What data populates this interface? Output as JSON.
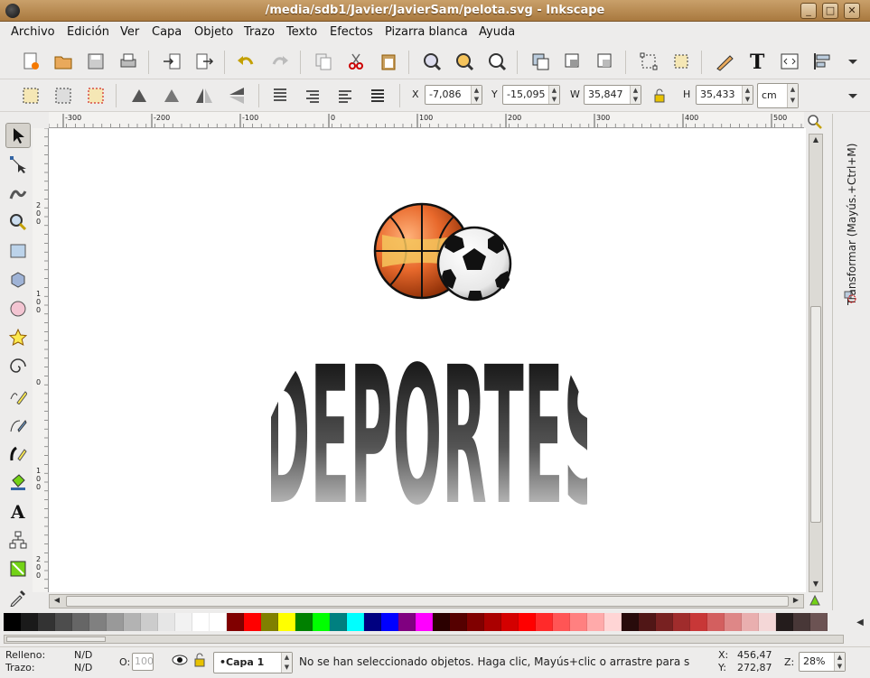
{
  "window": {
    "title": "/media/sdb1/Javier/JavierSam/pelota.svg - Inkscape",
    "buttons": [
      "_",
      "□",
      "✕"
    ]
  },
  "menu": [
    "Archivo",
    "Edición",
    "Ver",
    "Capa",
    "Objeto",
    "Trazo",
    "Texto",
    "Efectos",
    "Pizarra blanca",
    "Ayuda"
  ],
  "toolbar2": {
    "x": {
      "label": "X",
      "value": "-7,086"
    },
    "y": {
      "label": "Y",
      "value": "-15,095"
    },
    "w": {
      "label": "W",
      "value": "35,847"
    },
    "h": {
      "label": "H",
      "value": "35,433"
    },
    "unit": "cm"
  },
  "ruler": {
    "h_ticks": [
      "-300",
      "-200",
      "-100",
      "0",
      "100",
      "200",
      "300",
      "400",
      "500"
    ],
    "v_ticks": [
      "200",
      "100",
      "0",
      "100",
      "200"
    ]
  },
  "canvas": {
    "artwork_text": "DEPORTES",
    "ball_colors": {
      "basket": "#e8692c",
      "basket_accent": "#f5c45c",
      "soccer": "#111111"
    }
  },
  "dock": {
    "label": "Transformar (Mayús.+Ctrl+M)"
  },
  "palette": [
    "#000000",
    "#1a1a1a",
    "#333333",
    "#4d4d4d",
    "#666666",
    "#808080",
    "#999999",
    "#b3b3b3",
    "#cccccc",
    "#e6e6e6",
    "#f2f2f2",
    "#ffffff",
    "#ffffff",
    "#800000",
    "#ff0000",
    "#808000",
    "#ffff00",
    "#008000",
    "#00ff00",
    "#008080",
    "#00ffff",
    "#000080",
    "#0000ff",
    "#800080",
    "#ff00ff",
    "#2b0000",
    "#550000",
    "#800000",
    "#aa0000",
    "#d40000",
    "#ff0000",
    "#ff2a2a",
    "#ff5555",
    "#ff8080",
    "#ffaaaa",
    "#ffd5d5",
    "#280b0b",
    "#501616",
    "#782121",
    "#a02c2c",
    "#c83737",
    "#d35f5f",
    "#de8787",
    "#e9afaf",
    "#f4d7d7",
    "#241c1c",
    "#483737",
    "#6c5353"
  ],
  "status": {
    "fill_label": "Relleno:",
    "fill_value": "N/D",
    "stroke_label": "Trazo:",
    "stroke_value": "N/D",
    "opacity_label": "O:",
    "opacity_value": "100",
    "layer": "•Capa 1",
    "message": "No se han seleccionado objetos. Haga clic, Mayús+clic o arrastre para s",
    "x_label": "X:",
    "x_value": "456,47",
    "y_label": "Y:",
    "y_value": "272,87",
    "zoom_label": "Z:",
    "zoom_value": "28%"
  }
}
